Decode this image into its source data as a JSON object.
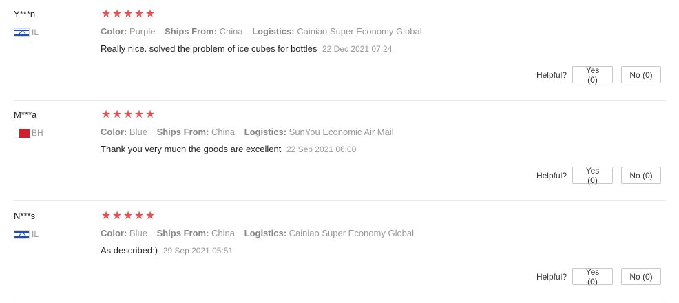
{
  "labels": {
    "color": "Color:",
    "ships_from": "Ships From:",
    "logistics": "Logistics:",
    "helpful": "Helpful?"
  },
  "star_color": "#ee4d4d",
  "reviews": [
    {
      "user": "Y***n",
      "country_code": "IL",
      "flag_icon": "israel-flag-icon",
      "rating": 5,
      "color": "Purple",
      "ships_from": "China",
      "logistics": "Cainiao Super Economy Global",
      "text": "Really nice. solved the problem of ice cubes for bottles",
      "date": "22 Dec 2021 07:24",
      "yes": "Yes (0)",
      "no": "No (0)"
    },
    {
      "user": "M***a",
      "country_code": "BH",
      "flag_icon": "bahrain-flag-icon",
      "rating": 5,
      "color": "Blue",
      "ships_from": "China",
      "logistics": "SunYou Economic Air Mail",
      "text": "Thank you very much the goods are excellent",
      "date": "22 Sep 2021 06:00",
      "yes": "Yes (0)",
      "no": "No (0)"
    },
    {
      "user": "N***s",
      "country_code": "IL",
      "flag_icon": "israel-flag-icon",
      "rating": 5,
      "color": "Blue",
      "ships_from": "China",
      "logistics": "Cainiao Super Economy Global",
      "text": "As described:)",
      "date": "29 Sep 2021 05:51",
      "yes": "Yes (0)",
      "no": "No (0)"
    }
  ]
}
